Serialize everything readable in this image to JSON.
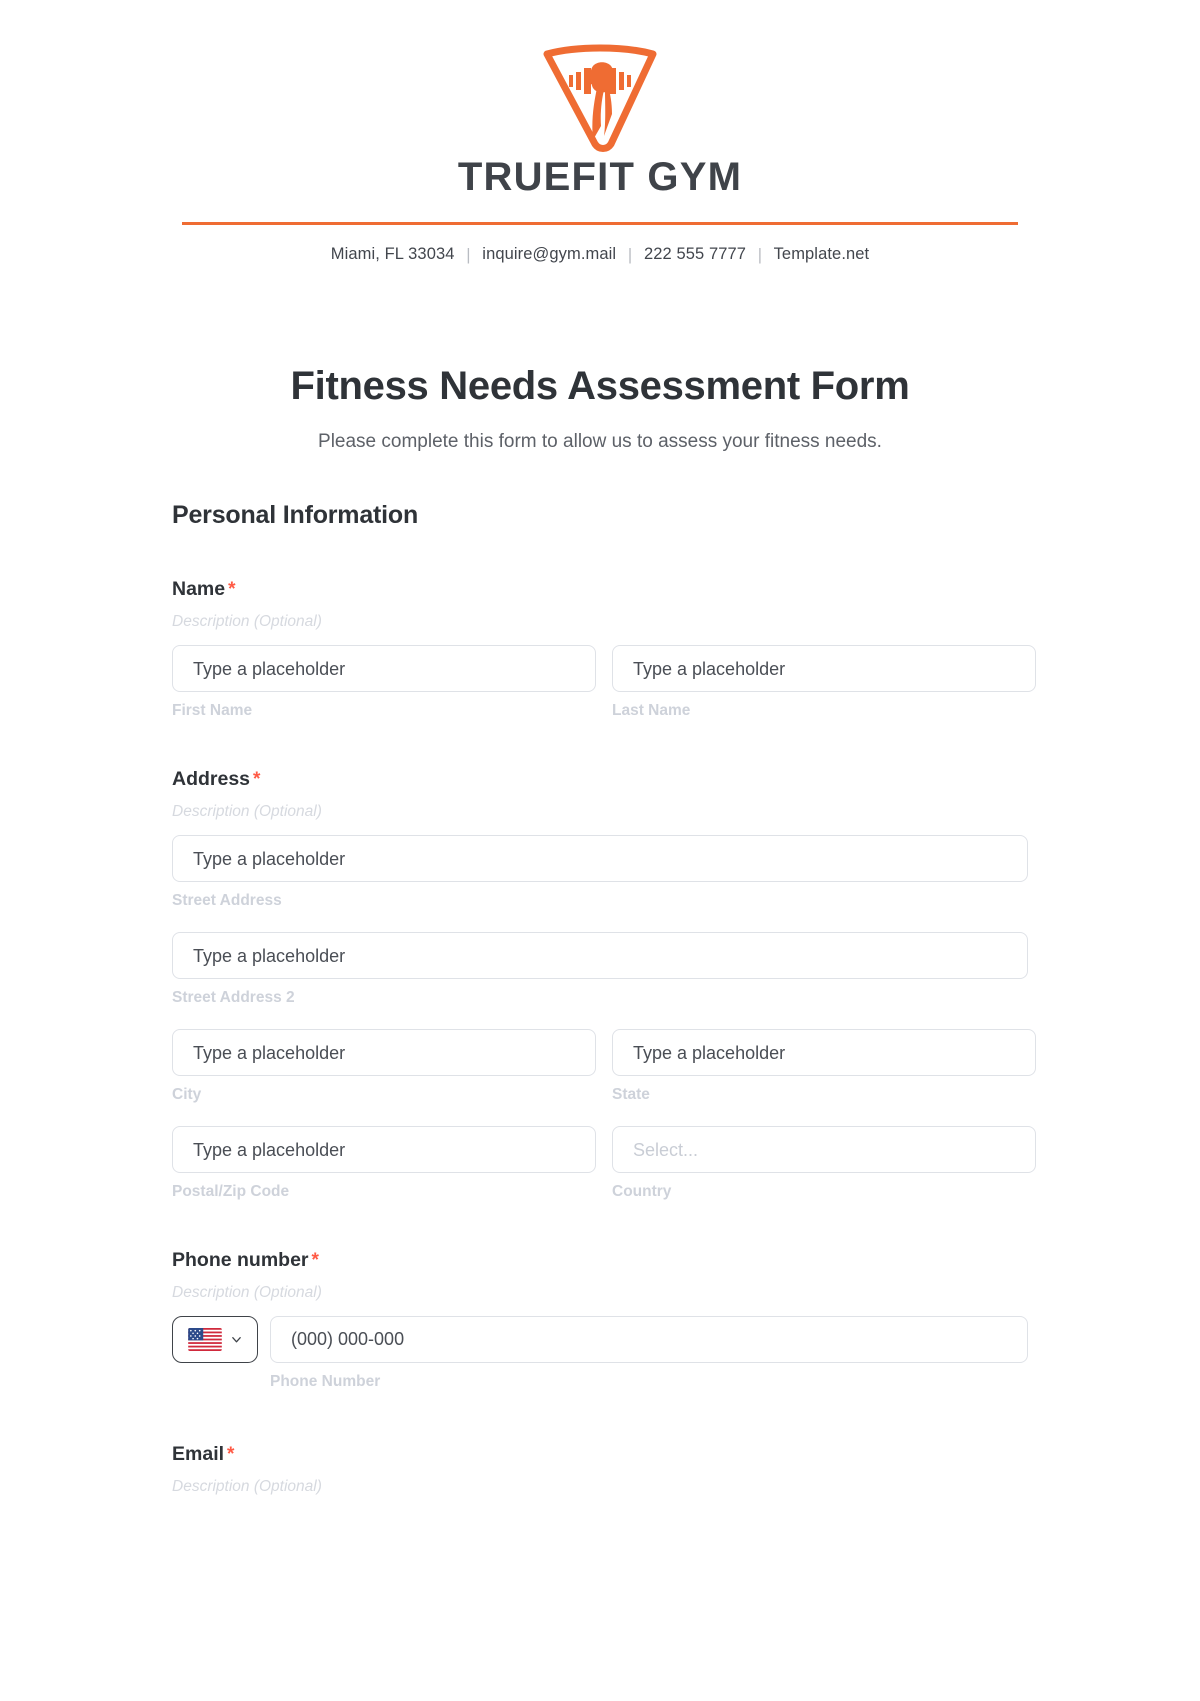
{
  "letterhead": {
    "logo_icon": "gym-shield-barbell-logo",
    "brand_name": "TRUEFIT GYM",
    "accent_color": "#ef6c33",
    "contact": {
      "address": "Miami, FL 33034",
      "email": "inquire@gym.mail",
      "phone": "222 555 7777",
      "website": "Template.net",
      "separator": "|"
    }
  },
  "form": {
    "title": "Fitness Needs Assessment Form",
    "subtitle": "Please complete this form to allow us to assess your fitness needs.",
    "section_title": "Personal Information",
    "required_marker": "*",
    "description_placeholder": "Description (Optional)",
    "text_placeholder": "Type a placeholder",
    "select_placeholder": "Select...",
    "fields": [
      {
        "label": "Name",
        "required": true,
        "description": "Description (Optional)",
        "inputs": [
          {
            "placeholder": "Type a placeholder",
            "sub_label": "First Name",
            "kind": "text"
          },
          {
            "placeholder": "Type a placeholder",
            "sub_label": "Last Name",
            "kind": "text"
          }
        ]
      },
      {
        "label": "Address",
        "required": true,
        "description": "Description (Optional)",
        "inputs": [
          {
            "placeholder": "Type a placeholder",
            "sub_label": "Street Address",
            "kind": "text"
          },
          {
            "placeholder": "Type a placeholder",
            "sub_label": "Street Address 2",
            "kind": "text"
          },
          {
            "placeholder": "Type a placeholder",
            "sub_label": "City",
            "kind": "text"
          },
          {
            "placeholder": "Type a placeholder",
            "sub_label": "State",
            "kind": "text"
          },
          {
            "placeholder": "Type a placeholder",
            "sub_label": "Postal/Zip Code",
            "kind": "text"
          },
          {
            "placeholder": "Select...",
            "sub_label": "Country",
            "kind": "select"
          }
        ]
      },
      {
        "label": "Phone number",
        "required": true,
        "description": "Description (Optional)",
        "country_flag": "us-flag-icon",
        "dropdown_icon": "chevron-down-icon",
        "inputs": [
          {
            "placeholder": "(000) 000-000",
            "sub_label": "Phone Number",
            "kind": "tel"
          }
        ]
      },
      {
        "label": "Email",
        "required": true,
        "description": "Description (Optional)",
        "inputs": []
      }
    ]
  }
}
